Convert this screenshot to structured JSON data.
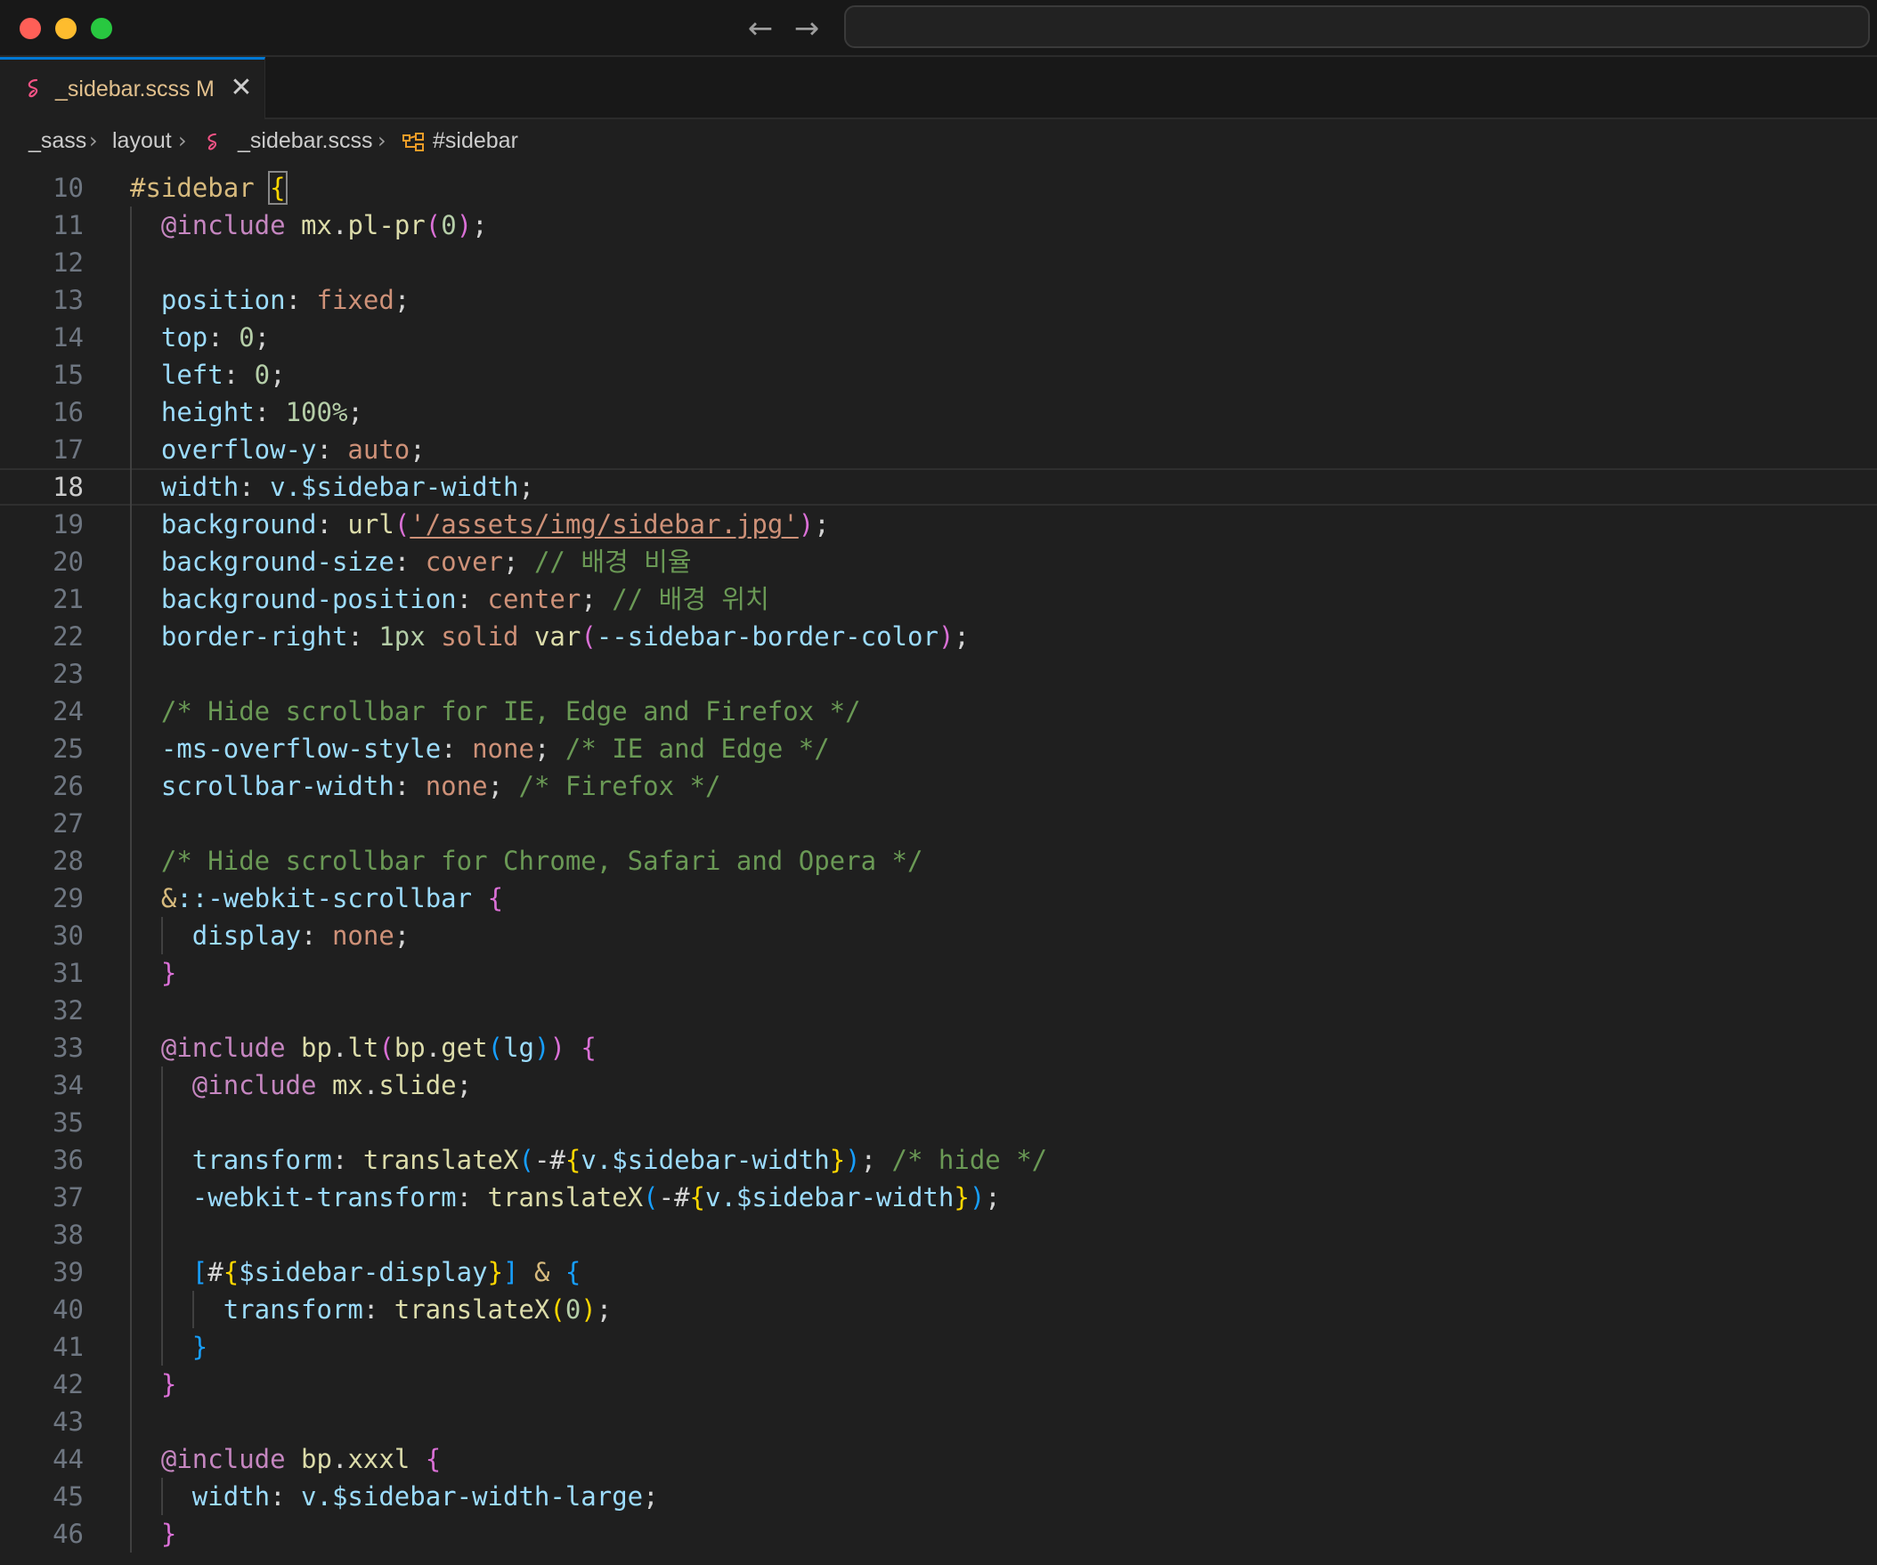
{
  "window": {
    "controls": [
      "close",
      "minimize",
      "maximize"
    ],
    "nav": {
      "back_icon": "←",
      "forward_icon": "→"
    }
  },
  "tab": {
    "label": "_sidebar.scss",
    "status": "M",
    "close_icon": "✕",
    "icon_color": "#f55385"
  },
  "breadcrumb": {
    "items": [
      "_sass",
      "layout",
      "_sidebar.scss",
      "#sidebar"
    ],
    "separator": "›"
  },
  "editor": {
    "current_line": 18,
    "lines": [
      {
        "n": "10",
        "i": 0,
        "t": [
          [
            "#sidebar",
            "sel"
          ],
          [
            " ",
            "tx"
          ],
          [
            "{",
            "b1 match"
          ]
        ]
      },
      {
        "n": "11",
        "i": 1,
        "t": [
          [
            "@include",
            "kw"
          ],
          [
            " ",
            "tx"
          ],
          [
            "mx",
            "fn"
          ],
          [
            ".",
            "tx"
          ],
          [
            "pl-pr",
            "fn"
          ],
          [
            "(",
            "b2"
          ],
          [
            "0",
            "num"
          ],
          [
            ")",
            "b2"
          ],
          [
            ";",
            "tx"
          ]
        ]
      },
      {
        "n": "12",
        "i": 1,
        "t": []
      },
      {
        "n": "13",
        "i": 1,
        "t": [
          [
            "position",
            "prop"
          ],
          [
            ": ",
            "tx"
          ],
          [
            "fixed",
            "val"
          ],
          [
            ";",
            "tx"
          ]
        ]
      },
      {
        "n": "14",
        "i": 1,
        "t": [
          [
            "top",
            "prop"
          ],
          [
            ": ",
            "tx"
          ],
          [
            "0",
            "num"
          ],
          [
            ";",
            "tx"
          ]
        ]
      },
      {
        "n": "15",
        "i": 1,
        "t": [
          [
            "left",
            "prop"
          ],
          [
            ": ",
            "tx"
          ],
          [
            "0",
            "num"
          ],
          [
            ";",
            "tx"
          ]
        ]
      },
      {
        "n": "16",
        "i": 1,
        "t": [
          [
            "height",
            "prop"
          ],
          [
            ": ",
            "tx"
          ],
          [
            "100%",
            "num"
          ],
          [
            ";",
            "tx"
          ]
        ]
      },
      {
        "n": "17",
        "i": 1,
        "t": [
          [
            "overflow-y",
            "prop"
          ],
          [
            ": ",
            "tx"
          ],
          [
            "auto",
            "val"
          ],
          [
            ";",
            "tx"
          ]
        ]
      },
      {
        "n": "18",
        "i": 1,
        "t": [
          [
            "width",
            "prop"
          ],
          [
            ": ",
            "tx"
          ],
          [
            "v.$sidebar-width",
            "prop"
          ],
          [
            ";",
            "tx"
          ]
        ]
      },
      {
        "n": "19",
        "i": 1,
        "t": [
          [
            "background",
            "prop"
          ],
          [
            ": ",
            "tx"
          ],
          [
            "url",
            "fn"
          ],
          [
            "(",
            "b2"
          ],
          [
            "'/assets/img/sidebar.jpg'",
            "str"
          ],
          [
            ")",
            "b2"
          ],
          [
            ";",
            "tx"
          ]
        ]
      },
      {
        "n": "20",
        "i": 1,
        "t": [
          [
            "background-size",
            "prop"
          ],
          [
            ": ",
            "tx"
          ],
          [
            "cover",
            "val"
          ],
          [
            "; ",
            "tx"
          ],
          [
            "// 배경 비율",
            "cm"
          ]
        ]
      },
      {
        "n": "21",
        "i": 1,
        "t": [
          [
            "background-position",
            "prop"
          ],
          [
            ": ",
            "tx"
          ],
          [
            "center",
            "val"
          ],
          [
            "; ",
            "tx"
          ],
          [
            "// 배경 위치",
            "cm"
          ]
        ]
      },
      {
        "n": "22",
        "i": 1,
        "t": [
          [
            "border-right",
            "prop"
          ],
          [
            ": ",
            "tx"
          ],
          [
            "1px",
            "num"
          ],
          [
            " ",
            "tx"
          ],
          [
            "solid",
            "val"
          ],
          [
            " ",
            "tx"
          ],
          [
            "var",
            "fn"
          ],
          [
            "(",
            "b2"
          ],
          [
            "--sidebar-border-color",
            "prop"
          ],
          [
            ")",
            "b2"
          ],
          [
            ";",
            "tx"
          ]
        ]
      },
      {
        "n": "23",
        "i": 1,
        "t": []
      },
      {
        "n": "24",
        "i": 1,
        "t": [
          [
            "/* Hide scrollbar for IE, Edge and Firefox */",
            "cm"
          ]
        ]
      },
      {
        "n": "25",
        "i": 1,
        "t": [
          [
            "-ms-overflow-style",
            "prop"
          ],
          [
            ": ",
            "tx"
          ],
          [
            "none",
            "val"
          ],
          [
            "; ",
            "tx"
          ],
          [
            "/* IE and Edge */",
            "cm"
          ]
        ]
      },
      {
        "n": "26",
        "i": 1,
        "t": [
          [
            "scrollbar-width",
            "prop"
          ],
          [
            ": ",
            "tx"
          ],
          [
            "none",
            "val"
          ],
          [
            "; ",
            "tx"
          ],
          [
            "/* Firefox */",
            "cm"
          ]
        ]
      },
      {
        "n": "27",
        "i": 1,
        "t": []
      },
      {
        "n": "28",
        "i": 1,
        "t": [
          [
            "/* Hide scrollbar for Chrome, Safari and Opera */",
            "cm"
          ]
        ]
      },
      {
        "n": "29",
        "i": 1,
        "t": [
          [
            "&",
            "sel"
          ],
          [
            "::-webkit-scrollbar",
            "prop"
          ],
          [
            " ",
            "tx"
          ],
          [
            "{",
            "b2"
          ]
        ]
      },
      {
        "n": "30",
        "i": 2,
        "t": [
          [
            "display",
            "prop"
          ],
          [
            ": ",
            "tx"
          ],
          [
            "none",
            "val"
          ],
          [
            ";",
            "tx"
          ]
        ]
      },
      {
        "n": "31",
        "i": 1,
        "t": [
          [
            "}",
            "b2"
          ]
        ]
      },
      {
        "n": "32",
        "i": 1,
        "t": []
      },
      {
        "n": "33",
        "i": 1,
        "t": [
          [
            "@include",
            "kw"
          ],
          [
            " ",
            "tx"
          ],
          [
            "bp",
            "fn"
          ],
          [
            ".",
            "tx"
          ],
          [
            "lt",
            "fn"
          ],
          [
            "(",
            "b2"
          ],
          [
            "bp",
            "fn"
          ],
          [
            ".",
            "tx"
          ],
          [
            "get",
            "fn"
          ],
          [
            "(",
            "b3"
          ],
          [
            "lg",
            "prop"
          ],
          [
            ")",
            "b3"
          ],
          [
            ")",
            "b2"
          ],
          [
            " ",
            "tx"
          ],
          [
            "{",
            "b2"
          ]
        ]
      },
      {
        "n": "34",
        "i": 2,
        "t": [
          [
            "@include",
            "kw"
          ],
          [
            " ",
            "tx"
          ],
          [
            "mx",
            "fn"
          ],
          [
            ".",
            "tx"
          ],
          [
            "slide",
            "fn"
          ],
          [
            ";",
            "tx"
          ]
        ]
      },
      {
        "n": "35",
        "i": 2,
        "t": []
      },
      {
        "n": "36",
        "i": 2,
        "t": [
          [
            "transform",
            "prop"
          ],
          [
            ": ",
            "tx"
          ],
          [
            "translateX",
            "fn"
          ],
          [
            "(",
            "b3"
          ],
          [
            "-#",
            "tx"
          ],
          [
            "{",
            "b1"
          ],
          [
            "v.$sidebar-width",
            "prop"
          ],
          [
            "}",
            "b1"
          ],
          [
            ")",
            "b3"
          ],
          [
            "; ",
            "tx"
          ],
          [
            "/* hide */",
            "cm"
          ]
        ]
      },
      {
        "n": "37",
        "i": 2,
        "t": [
          [
            "-webkit-transform",
            "prop"
          ],
          [
            ": ",
            "tx"
          ],
          [
            "translateX",
            "fn"
          ],
          [
            "(",
            "b3"
          ],
          [
            "-#",
            "tx"
          ],
          [
            "{",
            "b1"
          ],
          [
            "v.$sidebar-width",
            "prop"
          ],
          [
            "}",
            "b1"
          ],
          [
            ")",
            "b3"
          ],
          [
            ";",
            "tx"
          ]
        ]
      },
      {
        "n": "38",
        "i": 2,
        "t": []
      },
      {
        "n": "39",
        "i": 2,
        "t": [
          [
            "[",
            "b3"
          ],
          [
            "#",
            "tx"
          ],
          [
            "{",
            "b1"
          ],
          [
            "$sidebar-display",
            "prop"
          ],
          [
            "}",
            "b1"
          ],
          [
            "]",
            "b3"
          ],
          [
            " ",
            "tx"
          ],
          [
            "&",
            "sel"
          ],
          [
            " ",
            "tx"
          ],
          [
            "{",
            "b3"
          ]
        ]
      },
      {
        "n": "40",
        "i": 3,
        "t": [
          [
            "transform",
            "prop"
          ],
          [
            ": ",
            "tx"
          ],
          [
            "translateX",
            "fn"
          ],
          [
            "(",
            "b1"
          ],
          [
            "0",
            "num"
          ],
          [
            ")",
            "b1"
          ],
          [
            ";",
            "tx"
          ]
        ]
      },
      {
        "n": "41",
        "i": 2,
        "t": [
          [
            "}",
            "b3"
          ]
        ]
      },
      {
        "n": "42",
        "i": 1,
        "t": [
          [
            "}",
            "b2"
          ]
        ]
      },
      {
        "n": "43",
        "i": 1,
        "t": []
      },
      {
        "n": "44",
        "i": 1,
        "t": [
          [
            "@include",
            "kw"
          ],
          [
            " ",
            "tx"
          ],
          [
            "bp",
            "fn"
          ],
          [
            ".",
            "tx"
          ],
          [
            "xxxl",
            "fn"
          ],
          [
            " ",
            "tx"
          ],
          [
            "{",
            "b2"
          ]
        ]
      },
      {
        "n": "45",
        "i": 2,
        "t": [
          [
            "width",
            "prop"
          ],
          [
            ": ",
            "tx"
          ],
          [
            "v.$sidebar-width-large",
            "prop"
          ],
          [
            ";",
            "tx"
          ]
        ]
      },
      {
        "n": "46",
        "i": 1,
        "t": [
          [
            "}",
            "b2"
          ]
        ]
      }
    ]
  }
}
